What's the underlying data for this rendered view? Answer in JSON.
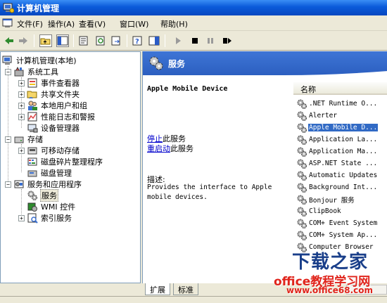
{
  "window": {
    "title": "计算机管理"
  },
  "menu": {
    "items": [
      "文件(F)",
      "操作(A)",
      "查看(V)",
      "窗口(W)",
      "帮助(H)"
    ]
  },
  "toolbar": {
    "buttons": [
      "back-arrow-icon",
      "forward-arrow-icon",
      "up-folder-icon",
      "show-hide-tree-icon",
      "properties-icon",
      "refresh-icon",
      "export-list-icon",
      "help-icon",
      "action-pane-icon",
      "play-icon",
      "stop-icon",
      "pause-icon",
      "restart-icon"
    ]
  },
  "tree": {
    "root": "计算机管理(本地)",
    "system_tools": "系统工具",
    "event_viewer": "事件查看器",
    "shared_folders": "共享文件夹",
    "local_users": "本地用户和组",
    "perf_logs": "性能日志和警报",
    "device_manager": "设备管理器",
    "storage": "存储",
    "removable_storage": "可移动存储",
    "defrag": "磁盘碎片整理程序",
    "disk_mgmt": "磁盘管理",
    "services_apps": "服务和应用程序",
    "services": "服务",
    "wmi": "WMI 控件",
    "indexing": "索引服务"
  },
  "header": {
    "title": "服务"
  },
  "details": {
    "service_name": "Apple Mobile Device",
    "stop_link": "停止",
    "stop_suffix": "此服务",
    "restart_link": "重启动",
    "restart_suffix": "此服务",
    "desc_label": "描述:",
    "desc_text": "Provides the interface to Apple mobile devices."
  },
  "list": {
    "column_name": "名称",
    "rows": [
      ".NET Runtime O...",
      "Alerter",
      "Apple Mobile D...",
      "Application La...",
      "Application Ma...",
      "ASP.NET State ...",
      "Automatic Updates",
      "Background Int...",
      "Bonjour 服务",
      "ClipBook",
      "COM+ Event System",
      "COM+ System Ap...",
      "Computer Browser"
    ],
    "selected_index": 2
  },
  "tabs": {
    "extended": "扩展",
    "standard": "标准"
  },
  "watermark": {
    "logo": "下载之家",
    "site": "office教程学习网",
    "url": "www.office68.com"
  },
  "colors": {
    "titlebar": "#0a5ad9",
    "header": "#2c5fc0",
    "selection": "#316ac5",
    "watermark_red": "#e0241b"
  }
}
